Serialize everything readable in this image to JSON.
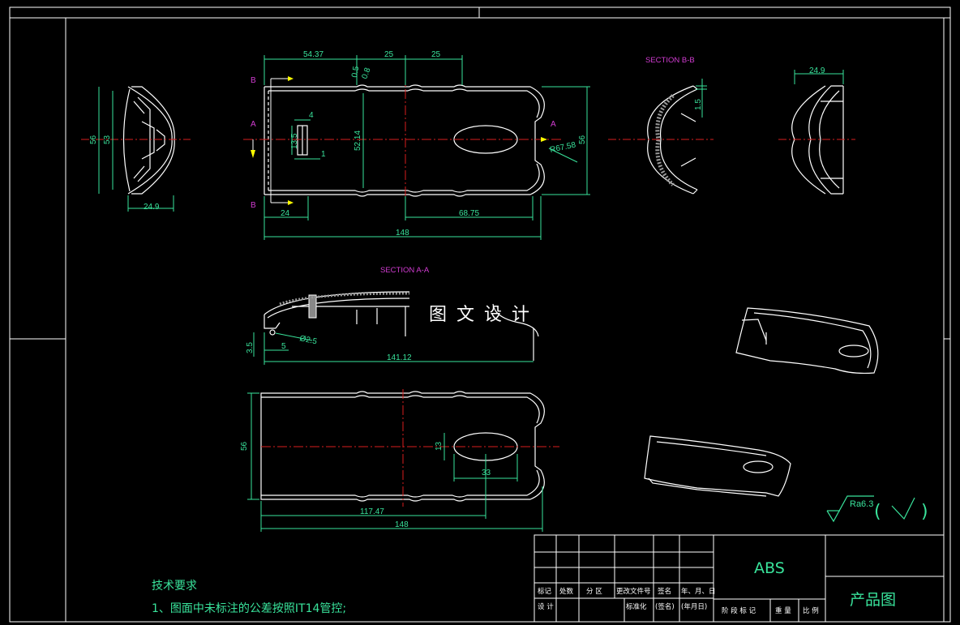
{
  "views": {
    "section_bb_title": "SECTION B-B",
    "section_aa_title": "SECTION A-A",
    "marker_b_top": "B",
    "marker_b_bottom": "B",
    "marker_a_left": "A",
    "marker_a_right": "A"
  },
  "dimensions": {
    "left_view_height_outer": "56",
    "left_view_height_inner": "53",
    "left_view_width": "24.9",
    "top_dim_1": "54.37",
    "top_dim_2": "25",
    "top_dim_3": "25",
    "small_dim_a": "0.5",
    "small_dim_b": "0.8",
    "slot_width": "4",
    "slot_height": "13.5",
    "slot_gap": "1",
    "inner_height": "52.14",
    "right_radius": "R67.58",
    "overall_height": "56",
    "bottom_dim_24": "24",
    "bottom_dim_6875": "68.75",
    "overall_length": "148",
    "section_bb_thickness": "1.5",
    "right_view_width": "24.9",
    "aa_height": "3.5",
    "aa_offset": "5",
    "aa_hole": "Ø2.5",
    "aa_length": "141.12",
    "bottom_view_height": "56",
    "oval_height": "13",
    "oval_width": "33",
    "bottom_dim_11747": "117.47",
    "bottom_overall_length": "148"
  },
  "watermark": "图文设计",
  "roughness": {
    "symbol_text": "Ra6.3",
    "paren_open": "(",
    "check": "√",
    "paren_close": ")"
  },
  "notes": {
    "heading": "技术要求",
    "line1": "1、图面中未标注的公差按照IT14管控;"
  },
  "title_block": {
    "material": "ABS",
    "drawing_name": "产品图",
    "row_labels": {
      "mark": "标记",
      "count": "处数",
      "zone": "分 区",
      "change_doc": "更改文件号",
      "signature": "签名",
      "date": "年、月、日",
      "design": "设 计",
      "standardize": "标准化",
      "sign_paren": "(签名)",
      "date_paren": "(年月日)",
      "stage_mark": "阶 段 标 记",
      "weight": "重 量",
      "scale": "比 例"
    }
  }
}
